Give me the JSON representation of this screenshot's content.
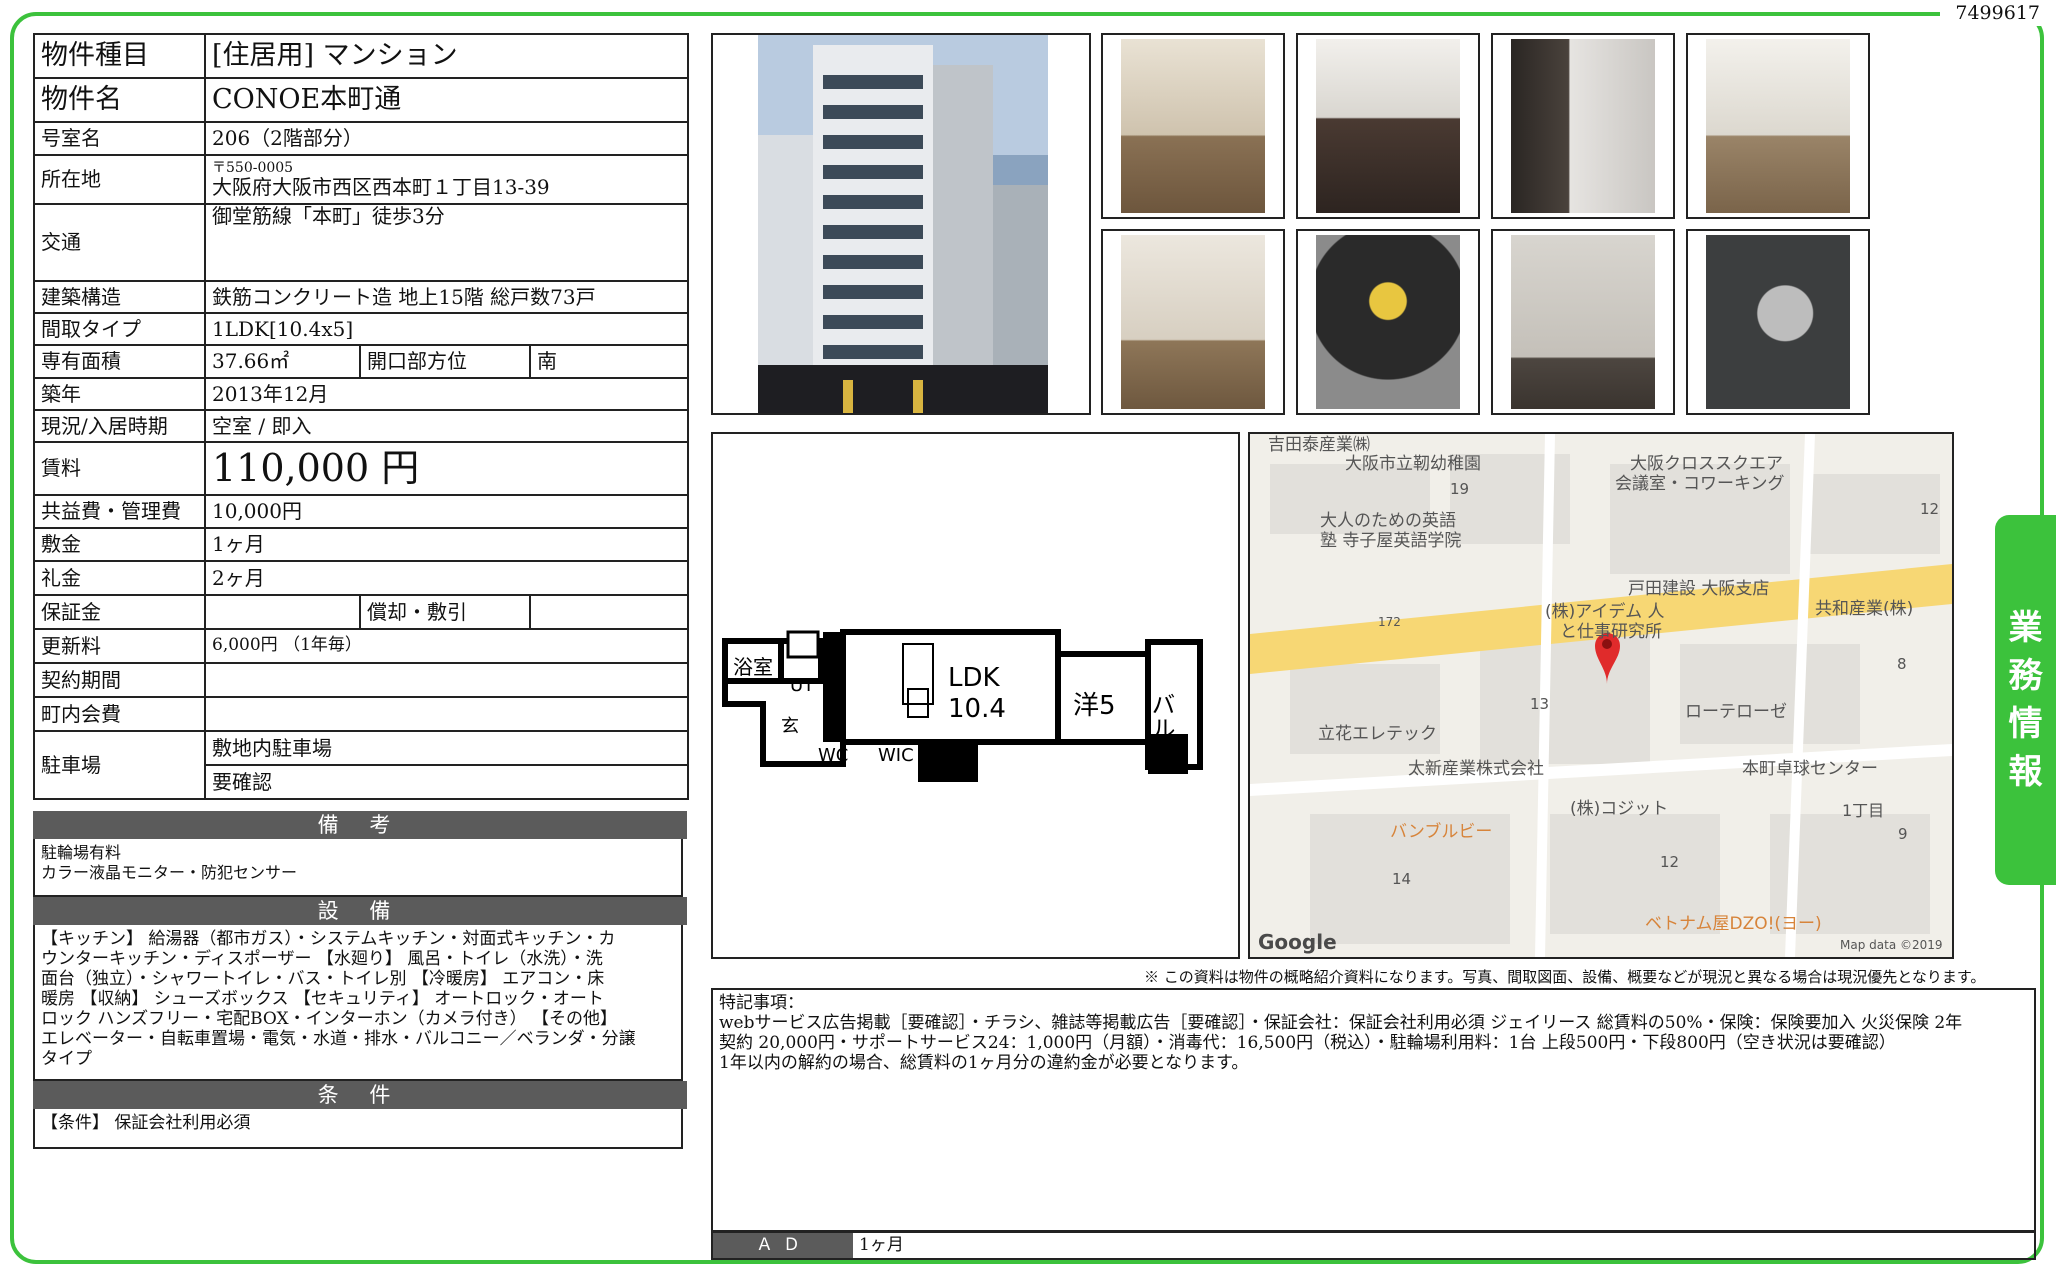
{
  "doc_id": "7499617",
  "side_tab": [
    "業",
    "務",
    "情",
    "報"
  ],
  "info": {
    "type_label": "物件種目",
    "type_value": "[住居用]  マンション",
    "name_label": "物件名",
    "name_value": "CONOE本町通",
    "room_label": "号室名",
    "room_value": "206（2階部分）",
    "address_label": "所在地",
    "postal": "〒550-0005",
    "address_value": "大阪府大阪市西区西本町１丁目13-39",
    "access_label": "交通",
    "access_value": "御堂筋線「本町」徒歩3分",
    "structure_label": "建築構造",
    "structure_value": "鉄筋コンクリート造  地上15階  総戸数73戸",
    "layout_label": "間取タイプ",
    "layout_value": "1LDK[10.4x5]",
    "area_label": "専有面積",
    "area_value": "37.66㎡",
    "direction_label": "開口部方位",
    "direction_value": "南",
    "built_label": "築年",
    "built_value": "2013年12月",
    "status_label": "現況/入居時期",
    "status_value": "空室  /  即入",
    "rent_label": "賃料",
    "rent_value": "110,000 円",
    "fee_label": "共益費・管理費",
    "fee_value": "10,000円",
    "deposit_label": "敷金",
    "deposit_value": "1ヶ月",
    "key_label": "礼金",
    "key_value": "2ヶ月",
    "guarantee_label": "保証金",
    "guarantee_value": "",
    "amort_label": "償却・敷引",
    "amort_value": "",
    "renewal_label": "更新料",
    "renewal_value": "6,000円  （1年毎）",
    "contract_label": "契約期間",
    "contract_value": "",
    "town_label": "町内会費",
    "town_value": "",
    "parking_label": "駐車場",
    "parking_value1": "敷地内駐車場",
    "parking_value2": "要確認"
  },
  "remarks": {
    "title": "備 考",
    "lines": [
      "駐輪場有料",
      "カラー液晶モニター・防犯センサー"
    ]
  },
  "equipment": {
    "title": "設 備",
    "lines": [
      "【キッチン】 給湯器（都市ガス）・システムキッチン・対面式キッチン・カ",
      "ウンターキッチン・ディスポーザー 【水廻り】 風呂・トイレ（水洗）・洗",
      "面台（独立）・シャワートイレ・バス・トイレ別 【冷暖房】 エアコン・床",
      "暖房 【収納】 シューズボックス 【セキュリティ】 オートロック・オート",
      "ロック ハンズフリー・宅配BOX・インターホン（カメラ付き）  【その他】",
      "エレベーター・自転車置場・電気・水道・排水・バルコニー／ベランダ・分譲",
      "タイプ"
    ]
  },
  "conditions": {
    "title": "条 件",
    "text": "【条件】 保証会社利用必須"
  },
  "floorplan": {
    "bath": "浴室",
    "ut": "UT",
    "entrance": "玄",
    "wc": "WC",
    "wic": "WIC",
    "ldk": "LDK",
    "ldk_size": "10.4",
    "western": "洋5",
    "balcony": "バル"
  },
  "map": {
    "labels": [
      "吉田泰産業㈱",
      "大阪市立靭幼稚園",
      "19",
      "大阪クロススクエア",
      "会議室・コワーキング",
      "12",
      "大人のための英語",
      "塾 寺子屋英語学院",
      "戸田建設 大阪支店",
      "172",
      "(株)アイデム 人",
      "と仕事研究所",
      "共和産業(株)",
      "8",
      "13",
      "ローテローゼ",
      "立花エレテック",
      "太新産業株式会社",
      "本町卓球センター",
      "1丁目",
      "(株)コジット",
      "9",
      "バンブルビー",
      "12",
      "14",
      "ベトナム屋DZO!(ヨー)",
      "Google",
      "Map data ©2019"
    ]
  },
  "disclaimer": "※ この資料は物件の概略紹介資料になります。写真、間取図面、設備、概要などが現況と異なる場合は現況優先となります。",
  "special": {
    "title": "特記事項：",
    "lines": [
      "webサービス広告掲載［要確認］・チラシ、雑誌等掲載広告［要確認］・保証会社：保証会社利用必須 ジェイリース 総賃料の50%・保険：保険要加入 火災保険 2年",
      "契約 20,000円・サポートサービス24：1,000円（月額）・消毒代：16,500円（税込）・駐輪場利用料：1台  上段500円・下段800円（空き状況は要確認）",
      "1年以内の解約の場合、総賃料の1ヶ月分の違約金が必要となります。"
    ]
  },
  "ad": {
    "label": "ＡＤ",
    "value": "1ヶ月"
  }
}
